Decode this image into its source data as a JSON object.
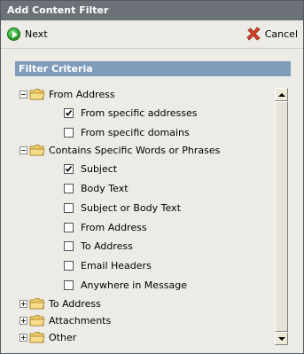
{
  "window": {
    "title": "Add Content Filter"
  },
  "toolbar": {
    "next_label": "Next",
    "cancel_label": "Cancel"
  },
  "section": {
    "title": "Filter Criteria"
  },
  "tree": {
    "from_address": {
      "label": "From Address",
      "expanded": true,
      "children": [
        {
          "label": "From specific addresses",
          "checked": true
        },
        {
          "label": "From specific domains",
          "checked": false
        }
      ]
    },
    "contains_words": {
      "label": "Contains Specific Words or Phrases",
      "expanded": true,
      "children": [
        {
          "label": "Subject",
          "checked": true
        },
        {
          "label": "Body Text",
          "checked": false
        },
        {
          "label": "Subject or Body Text",
          "checked": false
        },
        {
          "label": "From Address",
          "checked": false
        },
        {
          "label": "To Address",
          "checked": false
        },
        {
          "label": "Email Headers",
          "checked": false
        },
        {
          "label": "Anywhere in Message",
          "checked": false
        }
      ]
    },
    "to_address": {
      "label": "To Address",
      "expanded": false
    },
    "attachments": {
      "label": "Attachments",
      "expanded": false
    },
    "other": {
      "label": "Other",
      "expanded": false
    }
  },
  "colors": {
    "title_bar": "#6c7178",
    "section_header": "#7f9dbb",
    "background": "#ecebe6",
    "next_green": "#2fa52f",
    "cancel_red": "#d8432a",
    "folder_yellow": "#f0cd6a"
  },
  "icons": {
    "next": "green-circle-arrow",
    "cancel": "red-x",
    "folder": "folder",
    "expand": "plus-box",
    "collapse": "minus-box"
  }
}
